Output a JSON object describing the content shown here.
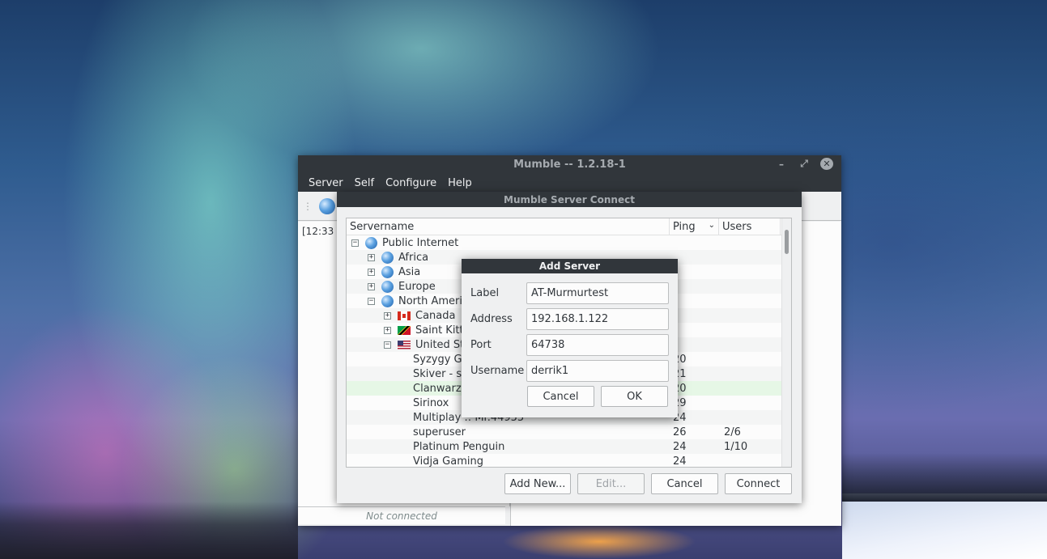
{
  "main_window": {
    "title": "Mumble -- 1.2.18-1",
    "controls": {
      "minimize": "–",
      "maximize": "⤢",
      "close": "✕"
    },
    "menu": [
      "Server",
      "Self",
      "Configure",
      "Help"
    ],
    "log_text": "[12:33",
    "status": "Not connected"
  },
  "connect_dialog": {
    "title": "Mumble Server Connect",
    "columns": {
      "name": "Servername",
      "ping": "Ping",
      "users": "Users"
    },
    "rows": [
      {
        "name": "Public Internet",
        "ping": "",
        "users": ""
      },
      {
        "name": "Africa",
        "ping": "",
        "users": ""
      },
      {
        "name": "Asia",
        "ping": "",
        "users": ""
      },
      {
        "name": "Europe",
        "ping": "",
        "users": ""
      },
      {
        "name": "North America",
        "ping": "",
        "users": ""
      },
      {
        "name": "Canada",
        "ping": "",
        "users": ""
      },
      {
        "name": "Saint Kitts and Nevis",
        "ping": "",
        "users": ""
      },
      {
        "name": "United States",
        "ping": "",
        "users": ""
      },
      {
        "name": "Syzygy Ga",
        "ping": "20",
        "users": ""
      },
      {
        "name": "Skiver - sk",
        "ping": "21",
        "users": ""
      },
      {
        "name": "Clanwarz",
        "ping": "20",
        "users": ""
      },
      {
        "name": "Sirinox",
        "ping": "29",
        "users": ""
      },
      {
        "name": "Multiplay :: Mr.44955",
        "ping": "24",
        "users": ""
      },
      {
        "name": "superuser",
        "ping": "26",
        "users": "2/6"
      },
      {
        "name": "Platinum Penguin",
        "ping": "24",
        "users": "1/10"
      },
      {
        "name": "Vidja Gaming",
        "ping": "24",
        "users": ""
      }
    ],
    "buttons": {
      "add_new": "Add New...",
      "edit": "Edit...",
      "cancel": "Cancel",
      "connect": "Connect"
    }
  },
  "add_server": {
    "title": "Add Server",
    "fields": {
      "label": {
        "label": "Label",
        "value": "AT-Murmurtest"
      },
      "address": {
        "label": "Address",
        "value": "192.168.1.122"
      },
      "port": {
        "label": "Port",
        "value": "64738"
      },
      "username": {
        "label": "Username",
        "value": "derrik1"
      }
    },
    "buttons": {
      "cancel": "Cancel",
      "ok": "OK"
    }
  }
}
